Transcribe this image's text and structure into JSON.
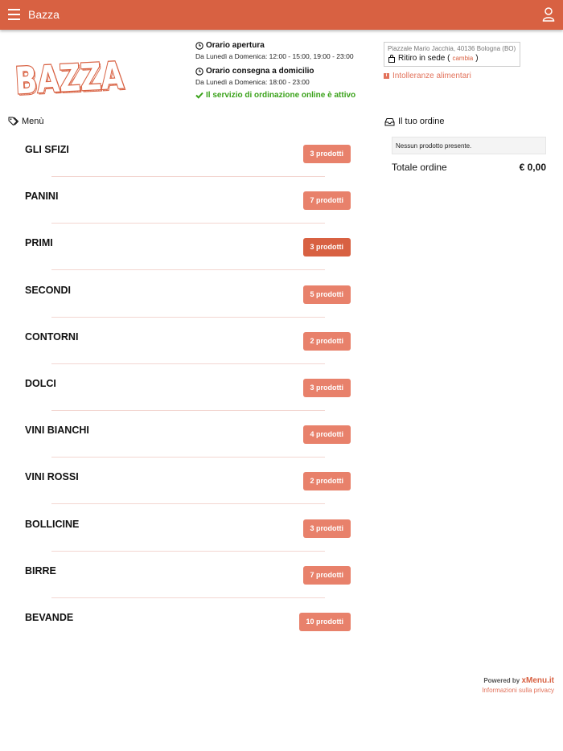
{
  "header": {
    "title": "Bazza",
    "menu_icon": "hamburger-icon",
    "user_icon": "user-icon",
    "color": "#d86142"
  },
  "logo": {
    "text": "BAZZA"
  },
  "hours": {
    "opening_title": "Orario apertura",
    "opening_text": "Da Lunedì a Domenica: 12:00 - 15:00, 19:00 - 23:00",
    "delivery_title": "Orario consegna a domicilio",
    "delivery_text": "Da Lunedì a Domenica: 18:00 - 23:00",
    "online_status": "Il servizio di ordinazione online è attivo"
  },
  "location": {
    "address": "Piazzale Mario Jacchia, 40136 Bologna (BO)",
    "pickup_label": "Ritiro in sede (",
    "change_label": "cambia",
    "pickup_close": ")",
    "intolerances": "Intolleranze alimentari"
  },
  "menu": {
    "title": "Menù",
    "categories": [
      {
        "name": "GLI SFIZI",
        "count": "3 prodotti"
      },
      {
        "name": "PANINI",
        "count": "7 prodotti"
      },
      {
        "name": "PRIMI",
        "count": "3 prodotti"
      },
      {
        "name": "SECONDI",
        "count": "5 prodotti"
      },
      {
        "name": "CONTORNI",
        "count": "2 prodotti"
      },
      {
        "name": "DOLCI",
        "count": "3 prodotti"
      },
      {
        "name": "VINI BIANCHI",
        "count": "4 prodotti"
      },
      {
        "name": "VINI ROSSI",
        "count": "2 prodotti"
      },
      {
        "name": "BOLLICINE",
        "count": "3 prodotti"
      },
      {
        "name": "BIRRE",
        "count": "7 prodotti"
      },
      {
        "name": "BEVANDE",
        "count": "10 prodotti"
      }
    ]
  },
  "order": {
    "title": "Il tuo ordine",
    "empty": "Nessun prodotto presente.",
    "total_label": "Totale ordine",
    "total_value": "€ 0,00"
  },
  "footer": {
    "powered_by": "Powered by ",
    "brand": "xMenu.it",
    "privacy": "Informazioni sulla privacy"
  }
}
